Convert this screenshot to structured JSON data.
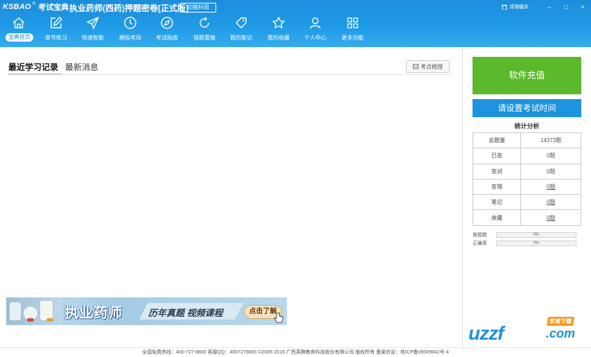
{
  "header": {
    "logo_text": "KSBAO",
    "logo_mark": "®",
    "logo_cn": "考试宝典",
    "title": "执业药师(西药)押题密卷[正式版]",
    "switch_label": "切换科目",
    "clear_cache_label": "清理缓存",
    "min_glyph": "–",
    "restore_glyph": "□",
    "close_glyph": "×"
  },
  "nav": [
    {
      "label": "宝典首页",
      "icon": "home-icon",
      "active": true
    },
    {
      "label": "章节练习",
      "icon": "edit-icon"
    },
    {
      "label": "快速智能",
      "icon": "send-icon"
    },
    {
      "label": "模拟考场",
      "icon": "clock-icon"
    },
    {
      "label": "考试指南",
      "icon": "compass-icon"
    },
    {
      "label": "错题重做",
      "icon": "refresh-icon"
    },
    {
      "label": "我的笔记",
      "icon": "tag-icon"
    },
    {
      "label": "我的收藏",
      "icon": "star-icon"
    },
    {
      "label": "个人中心",
      "icon": "user-icon"
    },
    {
      "label": "更多功能",
      "icon": "grid-icon"
    }
  ],
  "tabs": {
    "recent": "最近学习记录",
    "news": "最新消息",
    "kaodian_btn": "考点梳理"
  },
  "banner": {
    "title": "执业药师",
    "subtitle": "历年真题  视频课程",
    "button": "点击了解"
  },
  "side": {
    "recharge": "软件充值",
    "set_time": "请设置考试时间",
    "stats_title": "统计分析",
    "stats": [
      {
        "label": "总题量",
        "value": "14373题",
        "link": false
      },
      {
        "label": "已答",
        "value": "0题",
        "link": false
      },
      {
        "label": "答对",
        "value": "0题",
        "link": false
      },
      {
        "label": "答错",
        "value": "0题",
        "link": true
      },
      {
        "label": "笔记",
        "value": "0题",
        "link": true
      },
      {
        "label": "收藏",
        "value": "0题",
        "link": true
      }
    ],
    "progress": [
      {
        "label": "答题数",
        "value": "0%",
        "fraction": 0
      },
      {
        "label": "正确率",
        "value": "0%",
        "fraction": 0
      }
    ]
  },
  "watermark": {
    "main": "uzzf",
    "tag": "东坡下载",
    "suffix": ".com"
  },
  "footer": {
    "text": "全国免费热线：400-727-8800  客服QQ：4007278800   ©2005-2016  广西英腾教育科技股份有限公司 版权所有  备案信息：桂ICP备09009842号-4"
  },
  "colors": {
    "header": "#1f9ae6",
    "recharge": "#5cb92b",
    "set_time": "#1e93de"
  }
}
